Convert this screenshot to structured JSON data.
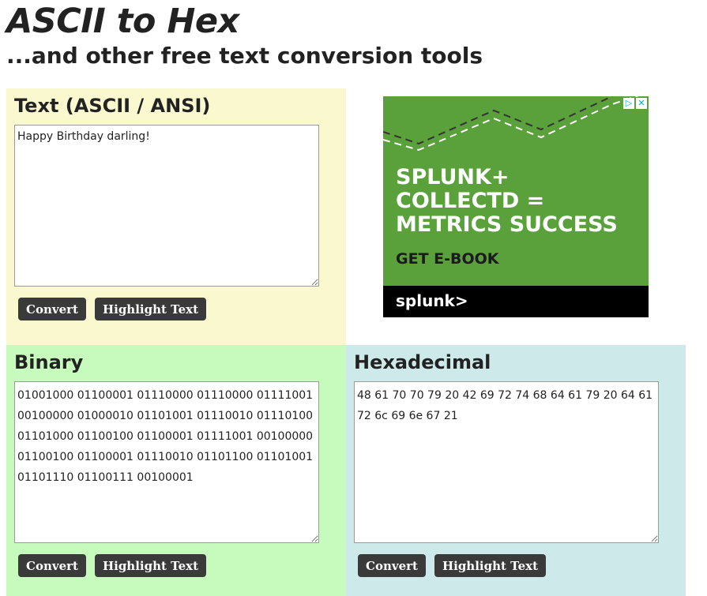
{
  "header": {
    "title": "ASCII to Hex",
    "subtitle": "...and other free text conversion tools"
  },
  "text_panel": {
    "label": "Text (ASCII / ANSI)",
    "value": "Happy Birthday darling!",
    "convert_label": "Convert",
    "highlight_label": "Highlight Text"
  },
  "binary_panel": {
    "label": "Binary",
    "value": "01001000 01100001 01110000 01110000 01111001 00100000 01000010 01101001 01110010 01110100 01101000 01100100 01100001 01111001 00100000 01100100 01100001 01110010 01101100 01101001 01101110 01100111 00100001",
    "convert_label": "Convert",
    "highlight_label": "Highlight Text"
  },
  "hex_panel": {
    "label": "Hexadecimal",
    "value": "48 61 70 70 79 20 42 69 72 74 68 64 61 79 20 64 61 72 6c 69 6e 67 21",
    "convert_label": "Convert",
    "highlight_label": "Highlight Text"
  },
  "ad": {
    "headline_line1": "SPLUNK+",
    "headline_line2": "COLLECTD =",
    "headline_line3": "METRICS SUCCESS",
    "cta": "GET E-BOOK",
    "logo": "splunk>",
    "adchoices_icon": "adchoices-icon",
    "close_icon": "close-icon",
    "background_color": "#5aa13c"
  },
  "colors": {
    "text_panel_bg": "#faf8cf",
    "binary_panel_bg": "#c6fbbd",
    "hex_panel_bg": "#cde9e9",
    "button_bg": "#3a3a3a"
  }
}
